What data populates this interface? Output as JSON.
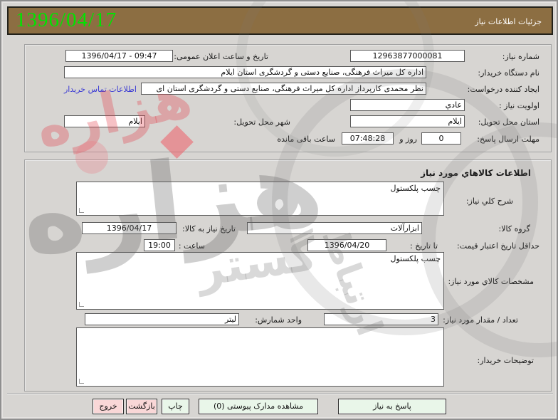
{
  "header": {
    "title": "جزئیات اطلاعات نیاز",
    "date": "1396/04/17"
  },
  "need_info": {
    "need_number_label": "شماره نیاز:",
    "need_number": "12963877000081",
    "announce_label": "تاریخ و ساعت اعلان عمومی:",
    "announce_value": "1396/04/17 - 09:47",
    "buyer_org_label": "نام دستگاه خریدار:",
    "buyer_org_value": "اداره کل میراث فرهنگی، صنایع دستی و گردشگری استان ایلام",
    "creator_label": "ایجاد کننده درخواست:",
    "creator_value": "نظر محمدی کارپرداز اداره کل میراث فرهنگی، صنایع دستی و گردشگری استان ای",
    "contact_link_label": "اطلاعات تماس خریدار",
    "priority_label": "اولویت نیاز :",
    "priority_value": "عادي",
    "province_label": "استان محل تحویل:",
    "province_value": "ایلام",
    "city_label": "شهر محل تحویل:",
    "city_value": "ایلام",
    "deadline_label": "مهلت ارسال پاسخ:",
    "deadline_days": "0",
    "deadline_days_suffix": "روز و",
    "deadline_time": "07:48:28",
    "deadline_suffix": "ساعت باقی مانده"
  },
  "goods_info": {
    "panel_title": "اطلاعات کالاهاي مورد نیاز",
    "general_desc_label": "شرح کلي نیاز:",
    "general_desc_value": "چسب پلکستول",
    "group_label": "گروه کالا:",
    "group_value": "ابزارآلات",
    "need_date_label": "تاریخ نیاز به کالا:",
    "need_date_value": "1396/04/17",
    "price_validity_label": "حداقل تاریخ اعتبار قیمت:",
    "until_date_label": "تا تاریخ :",
    "until_date_value": "1396/04/20",
    "hour_label": "ساعت :",
    "hour_value": "19:00",
    "specs_label": "مشخصات کالاي مورد نیاز:",
    "specs_value": "چسب پلکستول",
    "quantity_label": "تعداد / مقدار مورد نیاز:",
    "quantity_value": "3",
    "unit_label": "واحد شمارش:",
    "unit_value": "لیتر",
    "notes_label": "توضیحات خریدار:",
    "notes_value": ""
  },
  "footer_buttons": {
    "respond": "پاسخ به نیاز",
    "view_docs": "مشاهده مدارک پیوستی (0)",
    "print": "چاپ",
    "back": "بازگشت",
    "exit": "خروج"
  },
  "colors": {
    "header_bg": "#8c6e42",
    "header_date_green": "#00e400",
    "link_blue": "#3a3ad4",
    "button_green": "#e9f6e9",
    "button_pink": "#f9d7d7"
  },
  "watermark": {
    "word_main": "هزاره",
    "word_2": "گستر",
    "word_3": "ارتباط",
    "word_red": "هزاره"
  }
}
